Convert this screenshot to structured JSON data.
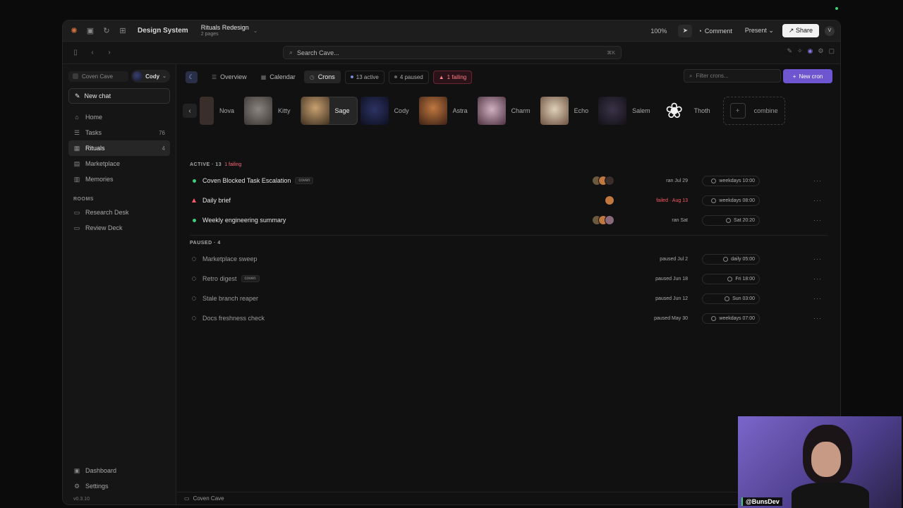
{
  "appbar": {
    "app_title": "Design System",
    "doc_title": "Rituals Redesign",
    "doc_subtitle": "2 pages",
    "zoom": "100%",
    "comment": "Comment",
    "present": "Present",
    "share": "Share",
    "avatar": "V"
  },
  "navbar": {
    "search_placeholder": "Search Cave...",
    "shortcut": "⌘K"
  },
  "sidebar": {
    "workspace": "Coven Cave",
    "user": "Cody",
    "new_chat": "New chat",
    "items": [
      {
        "label": "Home",
        "icon": "home-icon",
        "count": ""
      },
      {
        "label": "Tasks",
        "icon": "tasks-icon",
        "count": "76"
      },
      {
        "label": "Rituals",
        "icon": "rituals-icon",
        "count": "4"
      },
      {
        "label": "Marketplace",
        "icon": "marketplace-icon",
        "count": ""
      },
      {
        "label": "Memories",
        "icon": "memories-icon",
        "count": ""
      }
    ],
    "rooms_heading": "ROOMS",
    "rooms": [
      {
        "label": "Research Desk",
        "icon": "folder-icon"
      },
      {
        "label": "Review Deck",
        "icon": "folder-icon"
      }
    ],
    "bottom": [
      {
        "label": "Dashboard",
        "icon": "dashboard-icon"
      },
      {
        "label": "Settings",
        "icon": "gear-icon"
      }
    ],
    "version": "v0.3.10"
  },
  "toolbar": {
    "tabs": [
      {
        "label": "Overview",
        "icon": "list-icon"
      },
      {
        "label": "Calendar",
        "icon": "calendar-icon"
      },
      {
        "label": "Crons",
        "icon": "clock-icon"
      }
    ],
    "pill_active": "13 active",
    "pill_paused": "4 paused",
    "pill_failing": "1 failing",
    "filter_placeholder": "Filter crons...",
    "new_cron": "New cron"
  },
  "agents": {
    "list": [
      {
        "name": "Nova",
        "color": "#3a2e2a"
      },
      {
        "name": "Kitty",
        "color": "#5a5550"
      },
      {
        "name": "Sage",
        "color": "#6b5a3e"
      },
      {
        "name": "Cody",
        "color": "#1d2140"
      },
      {
        "name": "Astra",
        "color": "#7a4a2a"
      },
      {
        "name": "Charm",
        "color": "#8a6a7a"
      },
      {
        "name": "Echo",
        "color": "#b8a28a"
      },
      {
        "name": "Salem",
        "color": "#252030"
      },
      {
        "name": "Thoth",
        "color": "#eeeeee"
      }
    ],
    "combine": "combine"
  },
  "active_section": {
    "label": "ACTIVE · 13",
    "failing": "1 failing",
    "rows": [
      {
        "name": "Coven Blocked Task Escalation",
        "tag": "coven",
        "status": "ok",
        "last": "ran Jul 29",
        "schedule": "weekdays 10:00",
        "avatars": 3
      },
      {
        "name": "Daily brief",
        "tag": "",
        "status": "warn",
        "last": "failed · Aug 13",
        "schedule": "weekdays 08:00",
        "avatars": 1
      },
      {
        "name": "Weekly engineering summary",
        "tag": "",
        "status": "ok",
        "last": "ran Sat",
        "schedule": "Sat 20:20",
        "avatars": 3
      }
    ]
  },
  "paused_section": {
    "label": "PAUSED · 4",
    "rows": [
      {
        "name": "Marketplace sweep",
        "tag": "",
        "last": "paused Jul 2",
        "schedule": "daily 05:00"
      },
      {
        "name": "Retro digest",
        "tag": "coven",
        "last": "paused Jun 18",
        "schedule": "Fri 18:00"
      },
      {
        "name": "Stale branch reaper",
        "tag": "",
        "last": "paused Jun 12",
        "schedule": "Sun 03:00"
      },
      {
        "name": "Docs freshness check",
        "tag": "",
        "last": "paused May 30",
        "schedule": "weekdays 07:00"
      }
    ]
  },
  "footer": {
    "workspace": "Coven Cave"
  },
  "webcam": {
    "handle": "@BunsDev"
  },
  "colors": {
    "accent": "#6e56d0",
    "ok": "#3fcf78",
    "fail": "#ff5a68"
  }
}
